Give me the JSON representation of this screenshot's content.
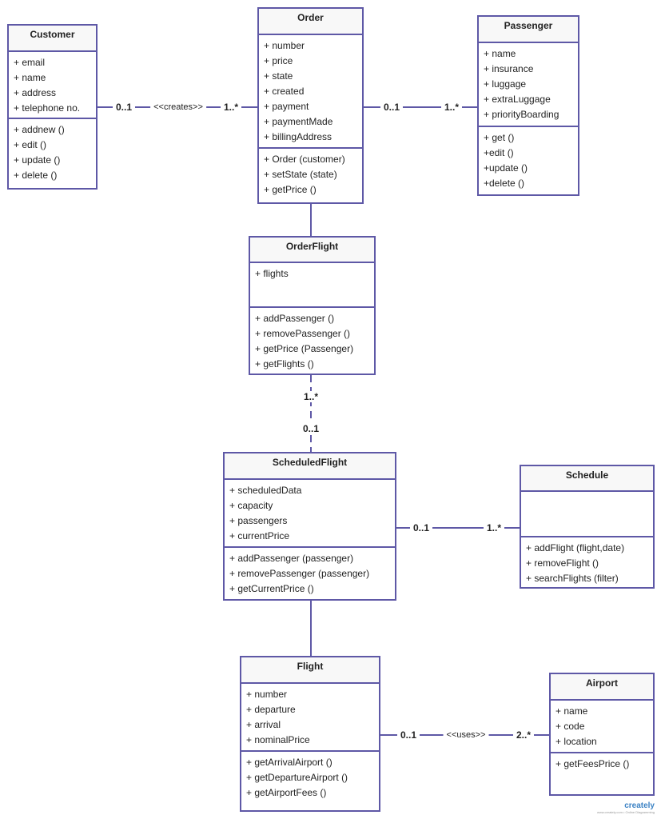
{
  "classes": [
    {
      "id": "customer",
      "name": "Customer",
      "attributes": [
        "+ email",
        "+ name",
        "+ address",
        "+ telephone no."
      ],
      "methods": [
        "+ addnew ()",
        "+ edit ()",
        "+ update ()",
        "+ delete ()"
      ]
    },
    {
      "id": "order",
      "name": "Order",
      "attributes": [
        "+ number",
        "+ price",
        "+ state",
        "+ created",
        "+ payment",
        "+ paymentMade",
        "+ billingAddress"
      ],
      "methods": [
        "+ Order (customer)",
        "+ setState (state)",
        "+ getPrice ()"
      ]
    },
    {
      "id": "passenger",
      "name": "Passenger",
      "attributes": [
        "+ name",
        "+ insurance",
        "+ luggage",
        "+ extraLuggage",
        "+ priorityBoarding"
      ],
      "methods": [
        "+ get ()",
        "+edit ()",
        "+update ()",
        "+delete ()"
      ]
    },
    {
      "id": "orderflight",
      "name": "OrderFlight",
      "attributes": [
        "+ flights"
      ],
      "methods": [
        "+ addPassenger ()",
        "+ removePassenger ()",
        "+ getPrice (Passenger)",
        "+ getFlights ()"
      ]
    },
    {
      "id": "scheduledflight",
      "name": "ScheduledFlight",
      "attributes": [
        "+ scheduledData",
        "+ capacity",
        "+ passengers",
        "+ currentPrice"
      ],
      "methods": [
        "+ addPassenger (passenger)",
        "+ removePassenger (passenger)",
        "+ getCurrentPrice ()"
      ]
    },
    {
      "id": "schedule",
      "name": "Schedule",
      "attributes": [],
      "methods": [
        "+ addFlight (flight,date)",
        "+ removeFlight ()",
        "+ searchFlights (filter)"
      ]
    },
    {
      "id": "flight",
      "name": "Flight",
      "attributes": [
        "+ number",
        "+ departure",
        "+ arrival",
        "+ nominalPrice"
      ],
      "methods": [
        "+ getArrivalAirport ()",
        "+ getDepartureAirport ()",
        "+ getAirportFees ()"
      ]
    },
    {
      "id": "airport",
      "name": "Airport",
      "attributes": [
        "+ name",
        "+ code",
        "+ location"
      ],
      "methods": [
        "+ getFeesPrice ()"
      ]
    }
  ],
  "connectors": [
    {
      "id": "customer-order",
      "from": "customer",
      "to": "order",
      "labels": [
        "0..1",
        "<<creates>>",
        "1..*"
      ],
      "style": "solid"
    },
    {
      "id": "order-passenger",
      "from": "order",
      "to": "passenger",
      "labels": [
        "0..1",
        "1..*"
      ],
      "style": "solid"
    },
    {
      "id": "order-orderflight",
      "from": "order",
      "to": "orderflight",
      "labels": [],
      "style": "solid"
    },
    {
      "id": "orderflight-scheduledflight",
      "from": "orderflight",
      "to": "scheduledflight",
      "labels": [
        "1..*",
        "0..1"
      ],
      "style": "dashed"
    },
    {
      "id": "scheduledflight-schedule",
      "from": "scheduledflight",
      "to": "schedule",
      "labels": [
        "0..1",
        "1..*"
      ],
      "style": "solid"
    },
    {
      "id": "scheduledflight-flight",
      "from": "scheduledflight",
      "to": "flight",
      "labels": [],
      "style": "solid"
    },
    {
      "id": "flight-airport",
      "from": "flight",
      "to": "airport",
      "labels": [
        "0..1",
        "<<uses>>",
        "2..*"
      ],
      "style": "solid"
    }
  ],
  "colors": {
    "border": "#5e58a6",
    "header_bg": "#f8f8f8"
  },
  "watermark": {
    "logo": "creately",
    "tagline": "www.creately.com • Online Diagramming"
  }
}
